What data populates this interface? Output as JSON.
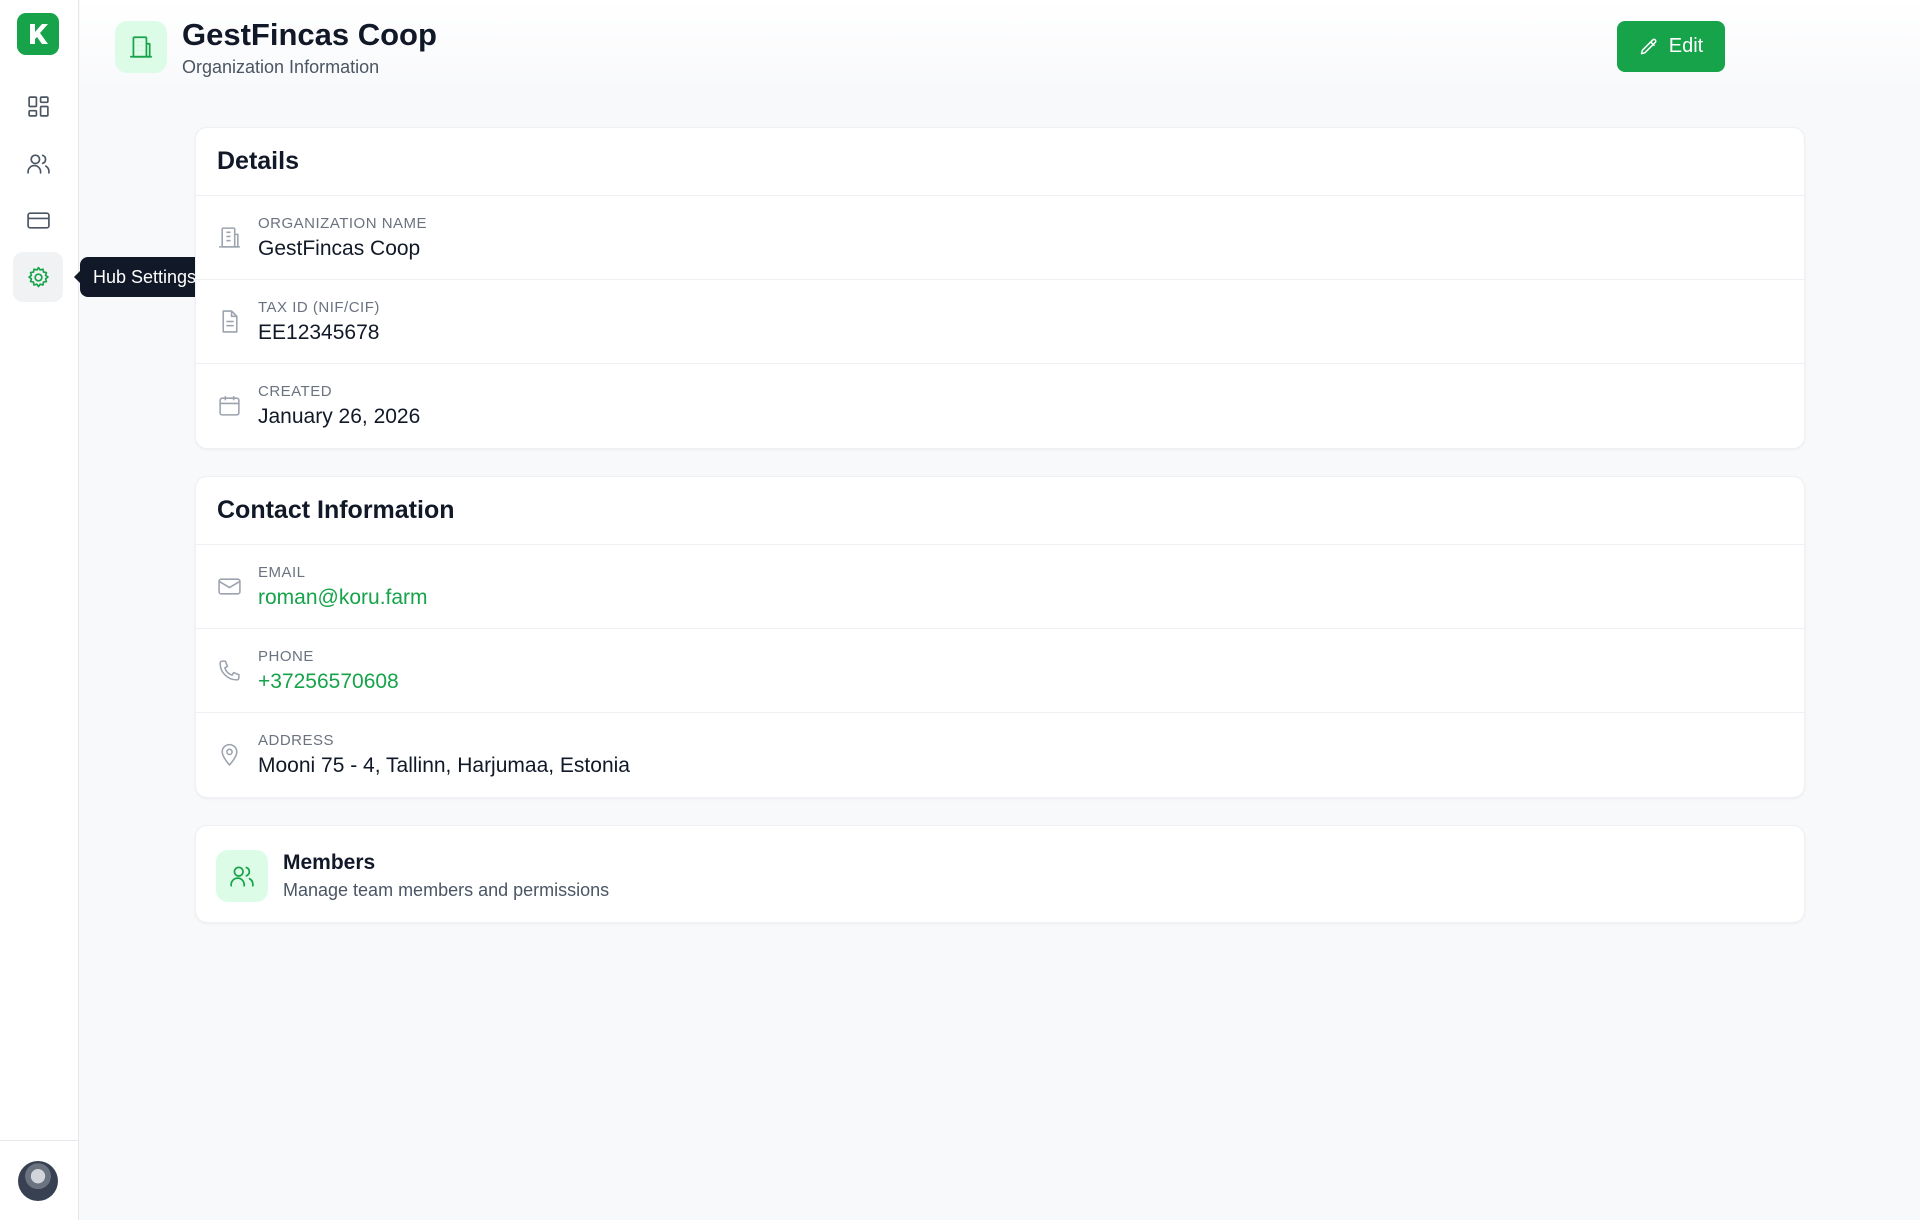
{
  "sidebar": {
    "tooltip": "Hub Settings",
    "items": [
      {
        "name": "dashboard",
        "icon": "dashboard-icon"
      },
      {
        "name": "users",
        "icon": "users-icon"
      },
      {
        "name": "billing",
        "icon": "credit-card-icon"
      },
      {
        "name": "hub-settings",
        "icon": "gear-icon",
        "active": true
      }
    ]
  },
  "header": {
    "title": "GestFincas Coop",
    "subtitle": "Organization Information",
    "edit_label": "Edit"
  },
  "details": {
    "title": "Details",
    "rows": [
      {
        "label": "Organization Name",
        "value": "GestFincas Coop",
        "icon": "building-icon"
      },
      {
        "label": "Tax ID (NIF/CIF)",
        "value": "EE12345678",
        "icon": "document-icon"
      },
      {
        "label": "Created",
        "value": "January 26, 2026",
        "icon": "calendar-icon"
      }
    ]
  },
  "contact": {
    "title": "Contact Information",
    "rows": [
      {
        "label": "Email",
        "value": "roman@koru.farm",
        "icon": "mail-icon"
      },
      {
        "label": "Phone",
        "value": "+37256570608",
        "icon": "phone-icon"
      },
      {
        "label": "Address",
        "value": "Mooni 75 - 4, Tallinn, Harjumaa, Estonia",
        "icon": "map-pin-icon"
      }
    ]
  },
  "members": {
    "title": "Members",
    "subtitle": "Manage team members and permissions"
  },
  "colors": {
    "accent": "#16a34a",
    "accent_light": "#dcfce7"
  }
}
